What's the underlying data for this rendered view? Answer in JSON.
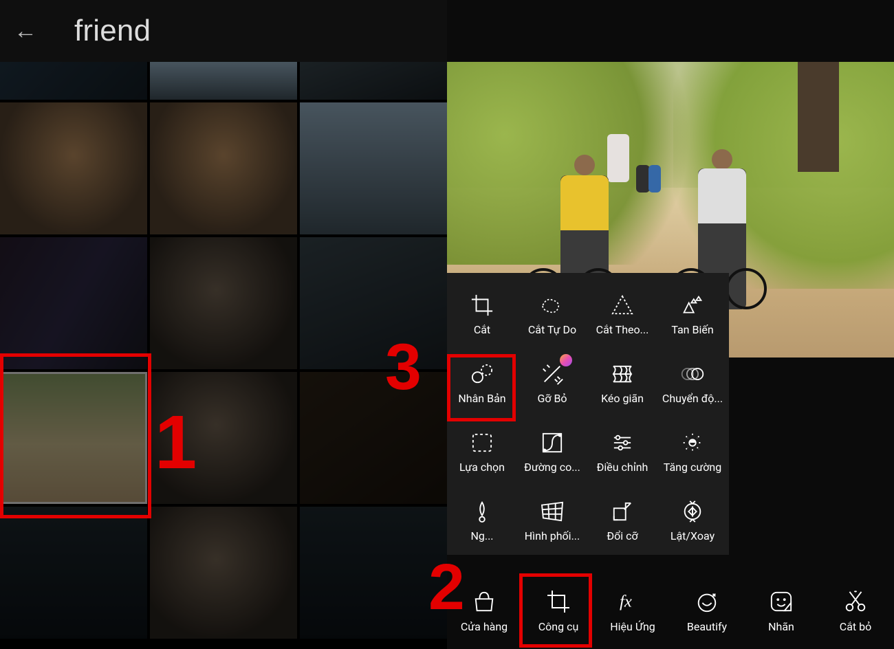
{
  "left": {
    "album_title": "friend",
    "selected_index": 6,
    "thumb_rows": 5
  },
  "editor": {
    "tools": [
      {
        "key": "crop",
        "label": "Cắt"
      },
      {
        "key": "freecrop",
        "label": "Cắt Tự Do"
      },
      {
        "key": "shapecrop",
        "label": "Cắt Theo..."
      },
      {
        "key": "dispersion",
        "label": "Tan Biến"
      },
      {
        "key": "clone",
        "label": "Nhân Bản"
      },
      {
        "key": "remove",
        "label": "Gỡ Bỏ",
        "premium": true
      },
      {
        "key": "stretch",
        "label": "Kéo giãn"
      },
      {
        "key": "motion",
        "label": "Chuyển độ..."
      },
      {
        "key": "selection",
        "label": "Lựa chọn"
      },
      {
        "key": "curves",
        "label": "Đường co..."
      },
      {
        "key": "adjust",
        "label": "Điều chỉnh"
      },
      {
        "key": "enhance",
        "label": "Tăng cường"
      },
      {
        "key": "tiltshift",
        "label": "Ng..."
      },
      {
        "key": "perspective",
        "label": "Hình phối..."
      },
      {
        "key": "resize",
        "label": "Đổi cỡ"
      },
      {
        "key": "fliprotate",
        "label": "Lật/Xoay"
      }
    ],
    "bottom": [
      {
        "key": "store",
        "label": "Cửa hàng"
      },
      {
        "key": "tools",
        "label": "Công cụ"
      },
      {
        "key": "effects",
        "label": "Hiệu Ứng"
      },
      {
        "key": "beautify",
        "label": "Beautify"
      },
      {
        "key": "sticker",
        "label": "Nhãn"
      },
      {
        "key": "cutout",
        "label": "Cắt bỏ"
      }
    ]
  },
  "annotations": {
    "step1": "1",
    "step2": "2",
    "step3": "3"
  }
}
